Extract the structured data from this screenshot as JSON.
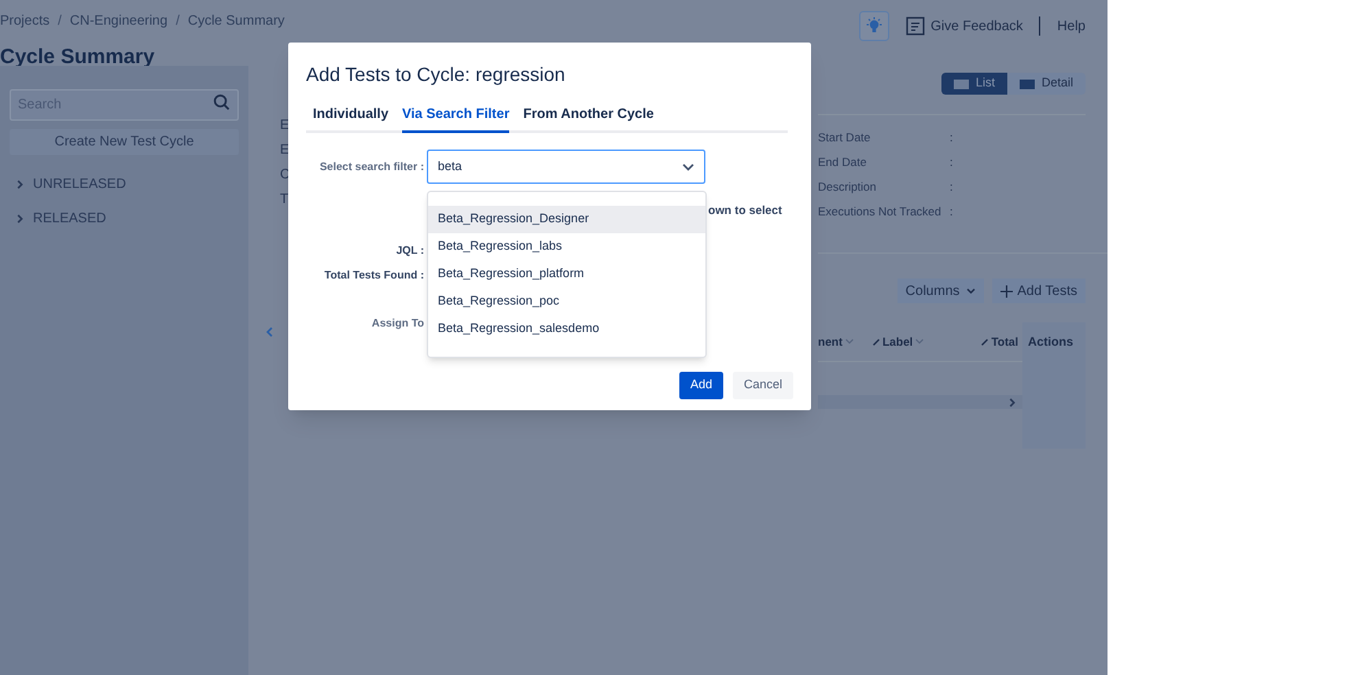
{
  "breadcrumb": [
    {
      "kind": "link",
      "text": "Projects"
    },
    {
      "kind": "separator",
      "text": "/"
    },
    {
      "kind": "link",
      "text": "CN-Engineering"
    },
    {
      "kind": "separator",
      "text": "/"
    },
    {
      "kind": "link",
      "text": "Cycle Summary"
    }
  ],
  "page_title": "Cycle Summary",
  "sidebar": {
    "search": {
      "placeholder": "Search"
    },
    "create_button": "Create New Test Cycle",
    "items": [
      {
        "label": "UNRELEASED",
        "expanded": false
      },
      {
        "label": "RELEASED",
        "expanded": false
      }
    ]
  },
  "header_actions": {
    "feedback": "Give Feedback",
    "help": "Help"
  },
  "view_toggle": [
    {
      "label": "List",
      "selected": true
    },
    {
      "label": "Detail",
      "selected": false
    }
  ],
  "details_fragments": [
    "E",
    "E",
    "C",
    "T"
  ],
  "details": [
    {
      "label": "Start Date",
      "separator": ":"
    },
    {
      "label": "End Date",
      "separator": ":"
    },
    {
      "label": "Description",
      "separator": ":"
    },
    {
      "label": "Executions Not Tracked",
      "separator": ":"
    }
  ],
  "table_toolbar": {
    "columns": "Columns",
    "add_tests": "Add Tests"
  },
  "table": {
    "columns": [
      {
        "label": "nent",
        "sortable": true,
        "pinned": false
      },
      {
        "label": "Label",
        "sortable": true,
        "pinned": true
      },
      {
        "label": "Total",
        "sortable": false,
        "pinned": true
      }
    ],
    "actions_column": "Actions"
  },
  "modal": {
    "title": "Add Tests to Cycle: regression",
    "tabs": [
      {
        "label": "Individually",
        "selected": false
      },
      {
        "label": "Via Search Filter",
        "selected": true
      },
      {
        "label": "From Another Cycle",
        "selected": false
      }
    ],
    "filter_label": "Select search filter :",
    "filter_value": "beta",
    "hint_fragment": "own to select",
    "jql_label": "JQL :",
    "total_label": "Total Tests Found :",
    "assign_label": "Assign To",
    "options": [
      {
        "label": "Beta_Regression_Designer",
        "selected": true
      },
      {
        "label": "Beta_Regression_labs",
        "selected": false
      },
      {
        "label": "Beta_Regression_platform",
        "selected": false
      },
      {
        "label": "Beta_Regression_poc",
        "selected": false
      },
      {
        "label": "Beta_Regression_salesdemo",
        "selected": false
      }
    ],
    "buttons": [
      {
        "label": "Add",
        "kind": "primary"
      },
      {
        "label": "Cancel",
        "kind": "secondary"
      }
    ]
  }
}
